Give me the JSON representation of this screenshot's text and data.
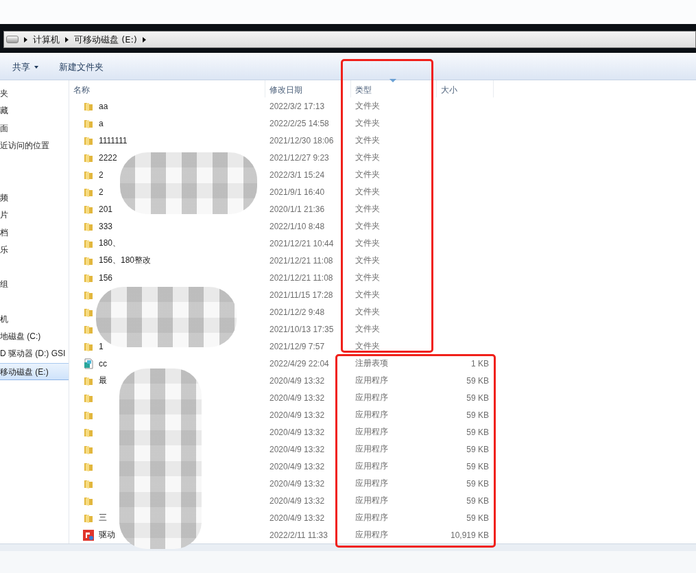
{
  "address_bar": {
    "segments": [
      "计算机",
      "可移动磁盘 (E:)"
    ]
  },
  "toolbar": {
    "buttons": [
      {
        "label": "共享",
        "kind": "menu"
      },
      {
        "label": "新建文件夹",
        "kind": "plain"
      }
    ]
  },
  "sidebar": {
    "groups": [
      {
        "items": [
          {
            "label": "夹",
            "selected": false
          },
          {
            "label": "藏",
            "selected": false
          },
          {
            "label": "面",
            "selected": false
          },
          {
            "label": "近访问的位置",
            "selected": false
          }
        ]
      },
      {
        "items": [
          {
            "label": "频",
            "selected": false
          },
          {
            "label": "片",
            "selected": false
          },
          {
            "label": "档",
            "selected": false
          },
          {
            "label": "乐",
            "selected": false
          }
        ]
      },
      {
        "items": [
          {
            "label": "组",
            "selected": false
          }
        ]
      },
      {
        "items": [
          {
            "label": "机",
            "selected": false
          },
          {
            "label": "地磁盘 (C:)",
            "selected": false
          },
          {
            "label": "D 驱动器 (D:) GSI",
            "selected": false
          },
          {
            "label": "移动磁盘 (E:)",
            "selected": true
          }
        ]
      }
    ]
  },
  "file_list": {
    "columns": [
      {
        "label": "名称",
        "sorted": false
      },
      {
        "label": "修改日期",
        "sorted": false
      },
      {
        "label": "类型",
        "sorted": true
      },
      {
        "label": "大小",
        "sorted": false
      }
    ],
    "rows": [
      {
        "kind": "folder",
        "name": "aa",
        "modified": "2022/3/2 17:13",
        "type": "文件夹"
      },
      {
        "kind": "folder",
        "name": "a",
        "modified": "2022/2/25 14:58",
        "type": "文件夹"
      },
      {
        "kind": "folder",
        "name": "1111111",
        "modified": "2021/12/30 18:06",
        "type": "文件夹"
      },
      {
        "kind": "folder",
        "name": "2222",
        "modified": "2021/12/27 9:23",
        "type": "文件夹"
      },
      {
        "kind": "folder",
        "name": "2",
        "modified": "2022/3/1 15:24",
        "type": "文件夹"
      },
      {
        "kind": "folder",
        "name": "2",
        "modified": "2021/9/1 16:40",
        "type": "文件夹"
      },
      {
        "kind": "folder",
        "name": "201",
        "modified": "2020/1/1 21:36",
        "type": "文件夹"
      },
      {
        "kind": "folder",
        "name": "333",
        "modified": "2022/1/10 8:48",
        "type": "文件夹"
      },
      {
        "kind": "folder",
        "name": "180、",
        "modified": "2021/12/21 10:44",
        "type": "文件夹"
      },
      {
        "kind": "folder",
        "name": "156、180整改",
        "modified": "2021/12/21 11:08",
        "type": "文件夹"
      },
      {
        "kind": "folder",
        "name": "156",
        "modified": "2021/12/21 11:08",
        "type": "文件夹"
      },
      {
        "kind": "folder",
        "modified": "2021/11/15 17:28",
        "type": "文件夹"
      },
      {
        "kind": "folder",
        "modified": "2021/12/2 9:48",
        "type": "文件夹"
      },
      {
        "kind": "folder",
        "modified": "2021/10/13 17:35",
        "type": "文件夹"
      },
      {
        "kind": "folder",
        "name": "1",
        "modified": "2021/12/9 7:57",
        "type": "文件夹"
      },
      {
        "kind": "registry",
        "name": "cc",
        "modified": "2022/4/29 22:04",
        "type": "注册表项",
        "size": "1 KB"
      },
      {
        "kind": "folder",
        "name": "最",
        "modified": "2020/4/9 13:32",
        "type": "应用程序",
        "size": "59 KB"
      },
      {
        "kind": "folder",
        "modified": "2020/4/9 13:32",
        "type": "应用程序",
        "size": "59 KB"
      },
      {
        "kind": "folder",
        "modified": "2020/4/9 13:32",
        "type": "应用程序",
        "size": "59 KB"
      },
      {
        "kind": "folder",
        "modified": "2020/4/9 13:32",
        "type": "应用程序",
        "size": "59 KB"
      },
      {
        "kind": "folder",
        "modified": "2020/4/9 13:32",
        "type": "应用程序",
        "size": "59 KB"
      },
      {
        "kind": "folder",
        "modified": "2020/4/9 13:32",
        "type": "应用程序",
        "size": "59 KB"
      },
      {
        "kind": "folder",
        "modified": "2020/4/9 13:32",
        "type": "应用程序",
        "size": "59 KB"
      },
      {
        "kind": "folder",
        "modified": "2020/4/9 13:32",
        "type": "应用程序",
        "size": "59 KB"
      },
      {
        "kind": "folder",
        "name": "三",
        "modified": "2020/4/9 13:32",
        "type": "应用程序",
        "size": "59 KB"
      },
      {
        "kind": "app",
        "name": "驱动",
        "modified": "2022/2/11 11:33",
        "type": "应用程序",
        "size": "10,919 KB"
      }
    ]
  }
}
